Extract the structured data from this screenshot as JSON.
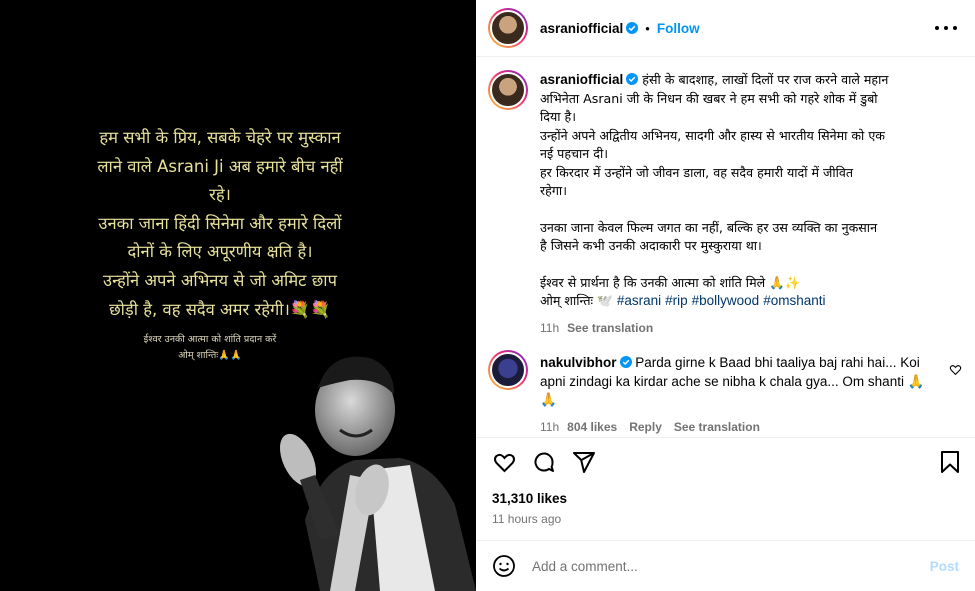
{
  "media": {
    "lines": [
      "हम सभी के प्रिय, सबके चेहरे पर मुस्कान",
      "लाने वाले Asrani Ji अब हमारे बीच नहीं",
      "रहे।",
      "उनका जाना हिंदी सिनेमा और हमारे दिलों",
      "दोनों के लिए अपूरणीय क्षति है।",
      "उन्होंने अपने अभिनय से जो अमिट छाप",
      "छोड़ी है, वह सदैव अमर रहेगी।"
    ],
    "flowers": "💐💐",
    "prayer_1": "ईश्वर उनकी आत्मा को शांति प्रदान करें",
    "prayer_2": "ओम् शान्तिः🙏🙏"
  },
  "header": {
    "username": "asraniofficial",
    "separator": "•",
    "follow_label": "Follow"
  },
  "caption": {
    "username": "asraniofficial",
    "lines": [
      "हंसी के बादशाह, लाखों दिलों पर राज करने वाले महान",
      "अभिनेता Asrani जी के निधन की खबर ने हम सभी को गहरे शोक में डुबो",
      "दिया है।",
      "उन्होंने अपने अद्वितीय अभिनय, सादगी और हास्य से भारतीय सिनेमा को एक",
      "नई पहचान दी।",
      "हर किरदार में उन्होंने जो जीवन डाला, वह सदैव हमारी यादों में जीवित",
      "रहेगा।",
      "",
      "उनका जाना केवल फिल्म जगत का नहीं, बल्कि हर उस व्यक्ति का नुकसान",
      "है जिसने कभी उनकी अदाकारी पर मुस्कुराया था।",
      "",
      "ईश्वर से प्रार्थना है कि उनकी आत्मा को शांति मिले 🙏✨"
    ],
    "last_line_prefix": "ओम् शान्तिः 🕊️",
    "hashtags": [
      "#asrani",
      "#rip",
      "#bollywood",
      "#omshanti"
    ],
    "time": "11h",
    "see_translation": "See translation"
  },
  "comment": {
    "username": "nakulvibhor",
    "text": "Parda girne k Baad bhi taaliya baj rahi hai... Koi apni zindagi ka kirdar ache se nibha k chala gya... Om shanti 🙏🙏",
    "time": "11h",
    "likes": "804 likes",
    "reply": "Reply",
    "see_translation": "See translation"
  },
  "post": {
    "likes": "31,310 likes",
    "time_ago": "11 hours ago"
  },
  "add_comment": {
    "placeholder": "Add a comment...",
    "post_label": "Post"
  },
  "colors": {
    "link": "#0095f6",
    "hashtag": "#00376b",
    "muted": "#737373",
    "media_text": "#e7e19b"
  }
}
